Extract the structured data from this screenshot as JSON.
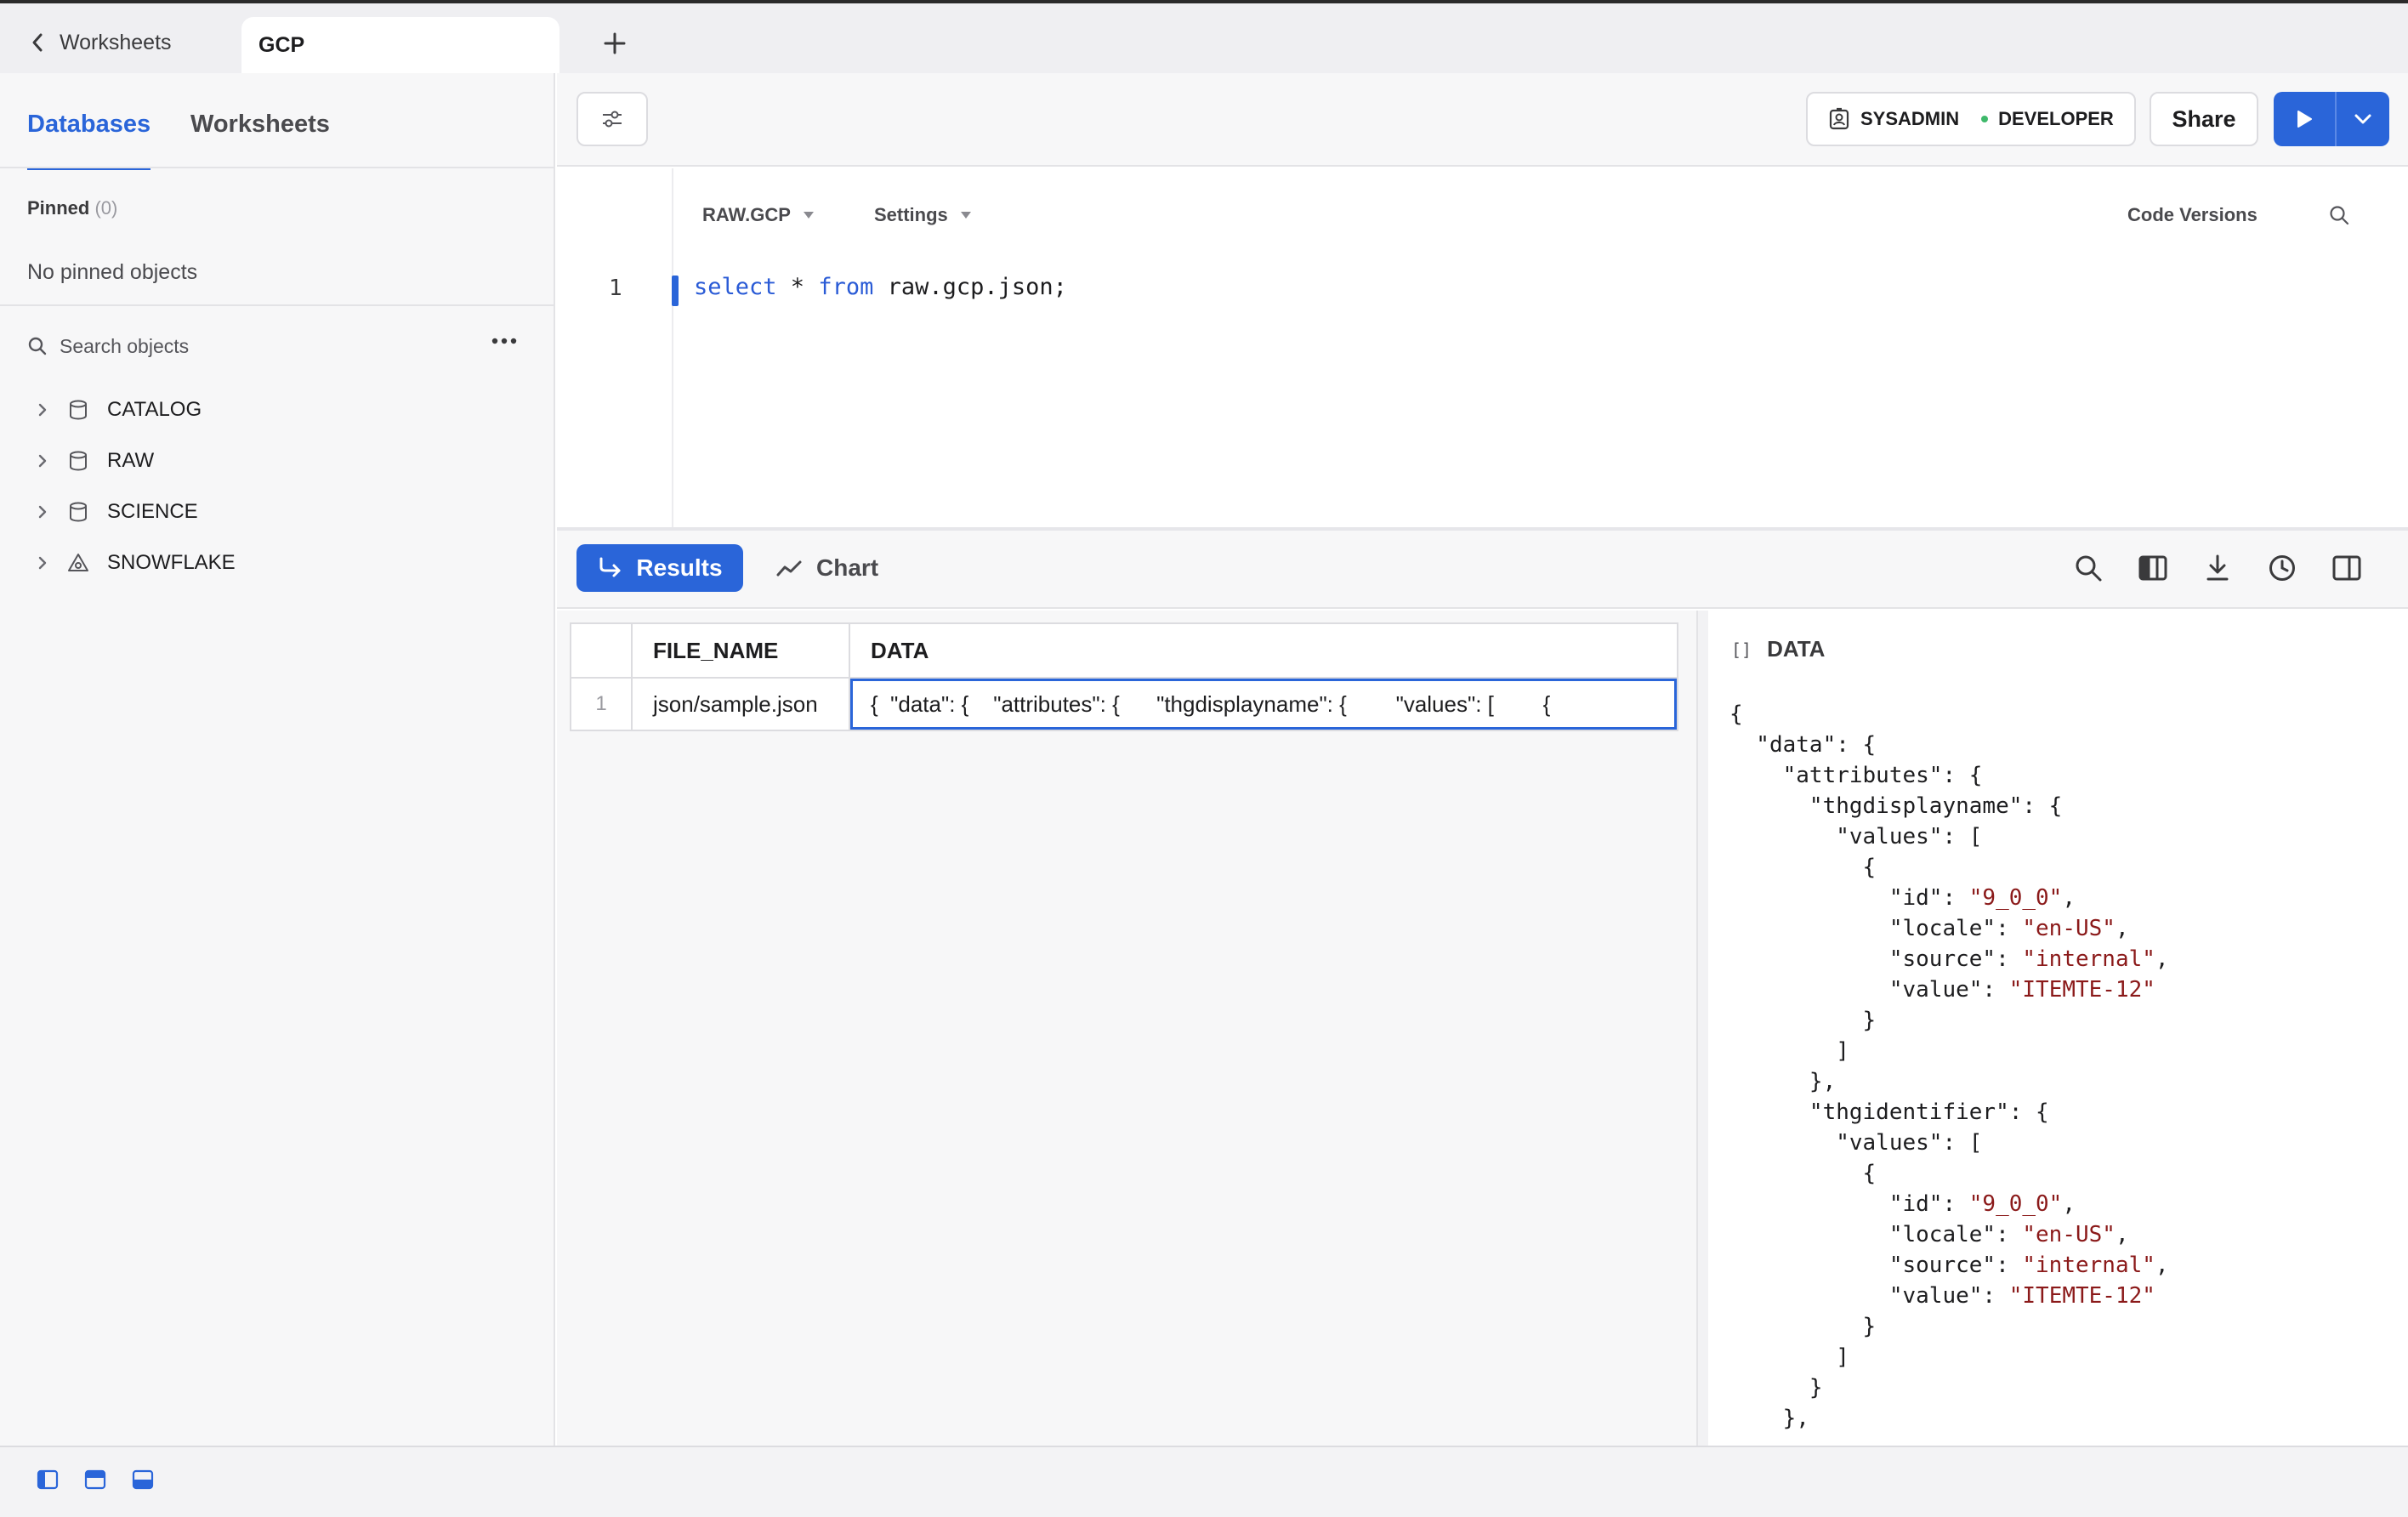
{
  "tabs": {
    "back_label": "Worksheets",
    "active_label": "GCP"
  },
  "sidebar": {
    "tab_databases": "Databases",
    "tab_worksheets": "Worksheets",
    "pinned_label": "Pinned",
    "pinned_count": "(0)",
    "no_pinned": "No pinned objects",
    "search_placeholder": "Search objects",
    "items": [
      {
        "label": "CATALOG",
        "icon": "database-icon"
      },
      {
        "label": "RAW",
        "icon": "database-icon"
      },
      {
        "label": "SCIENCE",
        "icon": "database-icon"
      },
      {
        "label": "SNOWFLAKE",
        "icon": "snowflake-share-icon"
      }
    ]
  },
  "toolbar": {
    "role": "SYSADMIN",
    "warehouse": "DEVELOPER",
    "share_label": "Share"
  },
  "editor": {
    "context_db": "RAW.GCP",
    "settings_label": "Settings",
    "code_versions_label": "Code Versions",
    "line_number": "1",
    "code": {
      "kw1": "select",
      "mid": " * ",
      "kw2": "from",
      "rest": " raw.gcp.json;"
    }
  },
  "results": {
    "results_label": "Results",
    "chart_label": "Chart",
    "columns": [
      "FILE_NAME",
      "DATA"
    ],
    "rows": [
      {
        "num": "1",
        "file_name": "json/sample.json",
        "data": "{  \"data\": {    \"attributes\": {      \"thgdisplayname\": {        \"values\": [        {"
      }
    ]
  },
  "panel": {
    "title": "DATA",
    "type_icon": "[]",
    "json_lines": [
      [
        [
          "{",
          ""
        ]
      ],
      [
        [
          "  \"data\": {",
          ""
        ]
      ],
      [
        [
          "    \"attributes\": {",
          ""
        ]
      ],
      [
        [
          "      \"thgdisplayname\": {",
          ""
        ]
      ],
      [
        [
          "        \"values\": [",
          ""
        ]
      ],
      [
        [
          "          {",
          ""
        ]
      ],
      [
        [
          "            \"id\": ",
          ""
        ],
        [
          "\"9_0_0\"",
          "s"
        ],
        [
          ",",
          ""
        ]
      ],
      [
        [
          "            \"locale\": ",
          ""
        ],
        [
          "\"en-US\"",
          "s"
        ],
        [
          ",",
          ""
        ]
      ],
      [
        [
          "            \"source\": ",
          ""
        ],
        [
          "\"internal\"",
          "s"
        ],
        [
          ",",
          ""
        ]
      ],
      [
        [
          "            \"value\": ",
          ""
        ],
        [
          "\"ITEMTE-12\"",
          "s"
        ]
      ],
      [
        [
          "          }",
          ""
        ]
      ],
      [
        [
          "        ]",
          ""
        ]
      ],
      [
        [
          "      },",
          ""
        ]
      ],
      [
        [
          "      \"thgidentifier\": {",
          ""
        ]
      ],
      [
        [
          "        \"values\": [",
          ""
        ]
      ],
      [
        [
          "          {",
          ""
        ]
      ],
      [
        [
          "            \"id\": ",
          ""
        ],
        [
          "\"9_0_0\"",
          "s"
        ],
        [
          ",",
          ""
        ]
      ],
      [
        [
          "            \"locale\": ",
          ""
        ],
        [
          "\"en-US\"",
          "s"
        ],
        [
          ",",
          ""
        ]
      ],
      [
        [
          "            \"source\": ",
          ""
        ],
        [
          "\"internal\"",
          "s"
        ],
        [
          ",",
          ""
        ]
      ],
      [
        [
          "            \"value\": ",
          ""
        ],
        [
          "\"ITEMTE-12\"",
          "s"
        ]
      ],
      [
        [
          "          }",
          ""
        ]
      ],
      [
        [
          "        ]",
          ""
        ]
      ],
      [
        [
          "      }",
          ""
        ]
      ],
      [
        [
          "    },",
          ""
        ]
      ]
    ]
  },
  "colors": {
    "accent": "#2a65d9",
    "string": "#8b1a1a",
    "status_dot": "#3fb96b"
  }
}
